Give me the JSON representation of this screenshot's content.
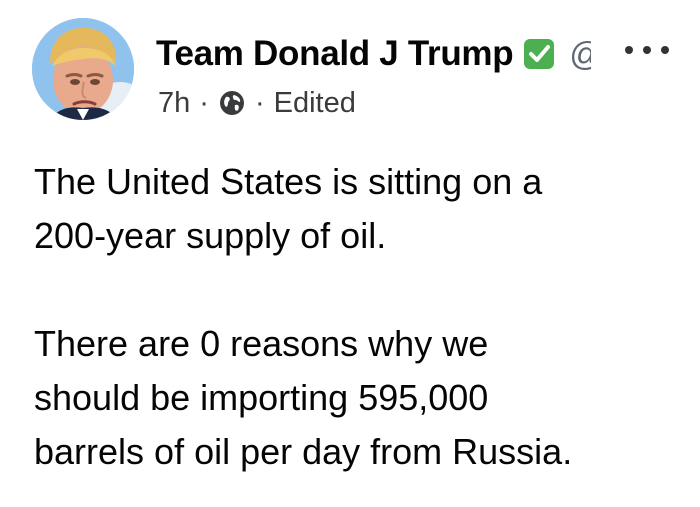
{
  "post": {
    "author": {
      "name": "Team Donald J Trump",
      "handle_fragment": "@"
    },
    "meta": {
      "time": "7h",
      "separator": "·",
      "audience_icon": "globe-icon",
      "edited_label": "Edited"
    },
    "menu_icon": "more-horizontal-icon",
    "verified_icon": "verified-check-icon",
    "body": {
      "paragraphs": [
        [
          "The United States is sitting on a",
          "200-year supply of oil."
        ],
        [
          "There are 0 reasons why we",
          "should be importing 595,000",
          "barrels of oil per day from Russia."
        ]
      ]
    }
  },
  "colors": {
    "verified_green": "#4caf50",
    "text": "#050505",
    "meta_text": "#3a3b3c",
    "avatar_background": "#8fc3ee"
  }
}
